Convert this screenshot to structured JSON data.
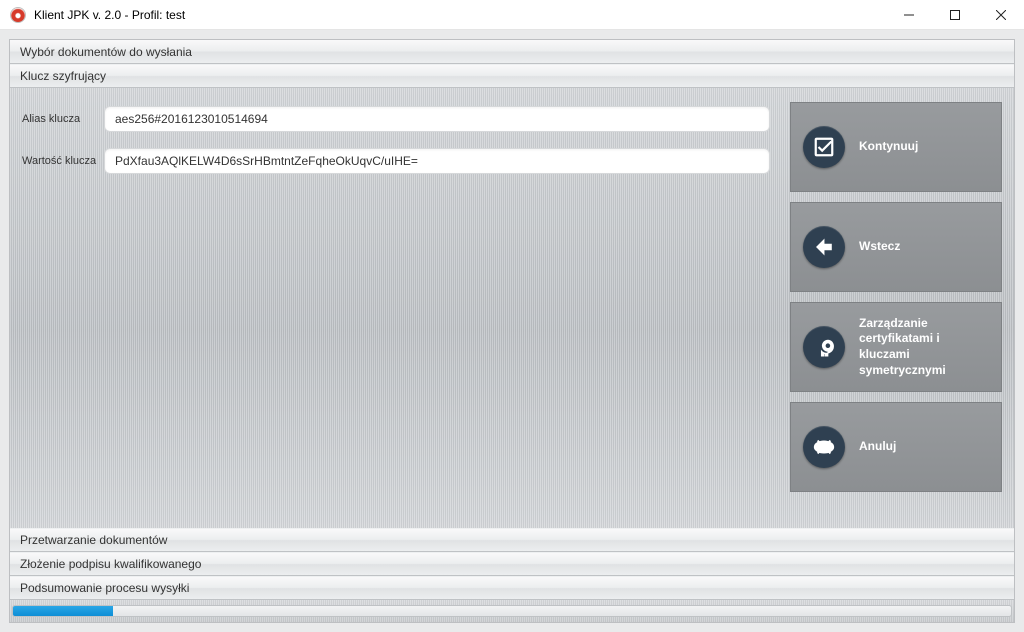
{
  "window": {
    "title": "Klient JPK v. 2.0 - Profil: test"
  },
  "sections": {
    "top1": "Wybór dokumentów do wysłania",
    "top2": "Klucz szyfrujący",
    "bottom1": "Przetwarzanie dokumentów",
    "bottom2": "Złożenie podpisu kwalifikowanego",
    "bottom3": "Podsumowanie procesu wysyłki"
  },
  "form": {
    "alias_label": "Alias klucza",
    "alias_value": "aes256#2016123010514694",
    "value_label": "Wartość klucza",
    "value_value": "PdXfau3AQlKELW4D6sSrHBmtntZeFqheOkUqvC/uIHE="
  },
  "buttons": {
    "continue": "Kontynuuj",
    "back": "Wstecz",
    "certs": "Zarządzanie certyfikatami i kluczami symetrycznymi",
    "cancel": "Anuluj"
  },
  "progress": {
    "percent": 10
  }
}
